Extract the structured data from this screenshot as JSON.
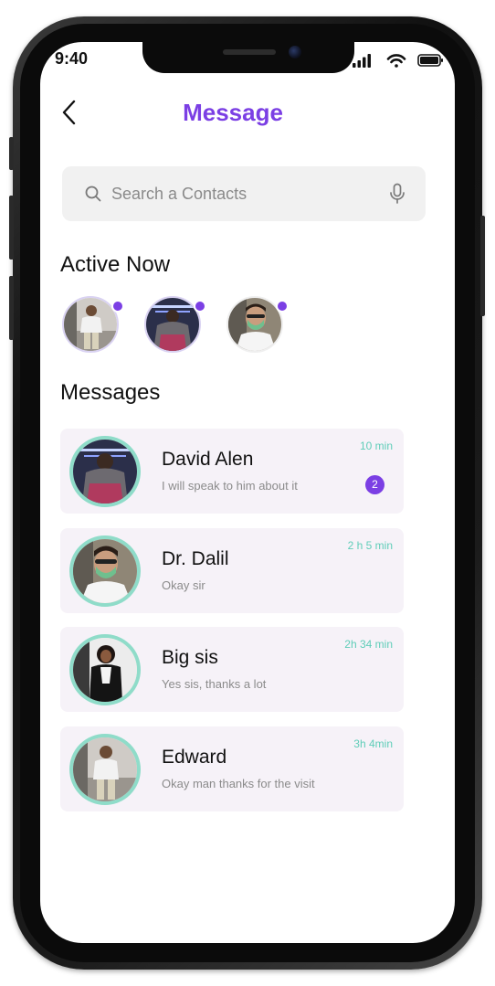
{
  "status_bar": {
    "time": "9:40"
  },
  "header": {
    "title": "Message"
  },
  "search": {
    "placeholder": "Search a Contacts",
    "value": ""
  },
  "active_now": {
    "title": "Active Now",
    "contacts": [
      {
        "avatar": "man in white hoodie on stairs",
        "online": true
      },
      {
        "avatar": "man in hooded jacket neon lights",
        "online": true
      },
      {
        "avatar": "doctor with green mask",
        "online": true
      }
    ]
  },
  "messages": {
    "title": "Messages",
    "items": [
      {
        "name": "David Alen",
        "text": "I will speak to him about it",
        "time": "10 min",
        "unread": "2"
      },
      {
        "name": "Dr. Dalil",
        "text": "Okay sir",
        "time": "2 h 5 min"
      },
      {
        "name": "Big sis",
        "text": "Yes sis, thanks a lot",
        "time": "2h 34 min"
      },
      {
        "name": "Edward",
        "text": "Okay man thanks for the visit",
        "time": "3h 4min"
      }
    ]
  },
  "colors": {
    "accent": "#7b3fe4",
    "time_color": "#5fcdb8",
    "card_bg": "#f6f2f8",
    "avatar_ring": "#8fdcc9"
  }
}
